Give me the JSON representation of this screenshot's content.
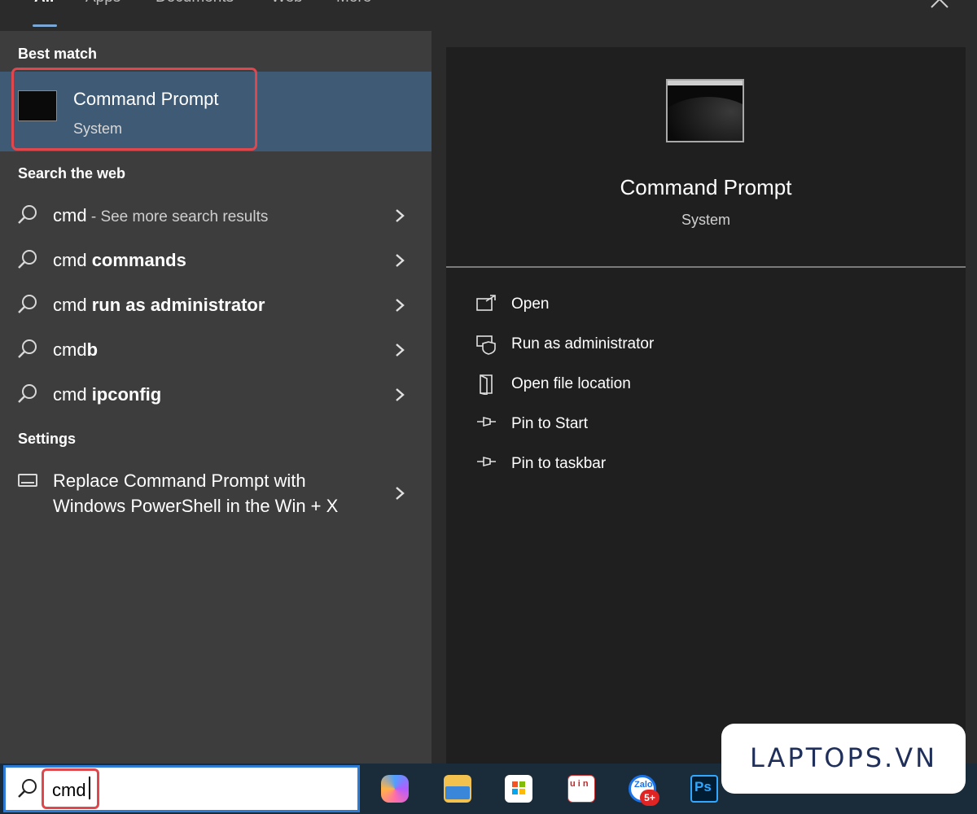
{
  "tabs": {
    "all": "All",
    "apps": "Apps",
    "documents": "Documents",
    "web": "Web",
    "more": "More",
    "overflow": "···"
  },
  "left": {
    "best_match_title": "Best match",
    "best_match": {
      "name": "Command Prompt",
      "type": "System"
    },
    "search_web_title": "Search the web",
    "web_results": [
      {
        "prefix": "cmd",
        "bold": "",
        "muted": " - See more search results"
      },
      {
        "prefix": "cmd ",
        "bold": "commands",
        "muted": ""
      },
      {
        "prefix": "cmd ",
        "bold": "run as administrator",
        "muted": ""
      },
      {
        "prefix": "cmd",
        "bold": "b",
        "muted": ""
      },
      {
        "prefix": "cmd ",
        "bold": "ipconfig",
        "muted": ""
      }
    ],
    "settings_title": "Settings",
    "settings_result": "Replace Command Prompt with Windows PowerShell in the Win + X"
  },
  "right": {
    "title": "Command Prompt",
    "subtitle": "System",
    "actions": [
      {
        "label": "Open",
        "icon": "open-icon"
      },
      {
        "label": "Run as administrator",
        "icon": "shield-icon"
      },
      {
        "label": "Open file location",
        "icon": "folder-location-icon"
      },
      {
        "label": "Pin to Start",
        "icon": "pin-icon"
      },
      {
        "label": "Pin to taskbar",
        "icon": "pin-icon"
      }
    ]
  },
  "taskbar": {
    "search_value": "cmd",
    "unikey_label": "u i n",
    "zalo_label": "Zalo",
    "zalo_badge": "5+",
    "photoshop_label": "Ps"
  },
  "watermark": "LAPTOPS.VN",
  "colors": {
    "selected_row": "#3e5a75",
    "highlight_box": "#e0474c",
    "search_border": "#2e7bd6"
  }
}
